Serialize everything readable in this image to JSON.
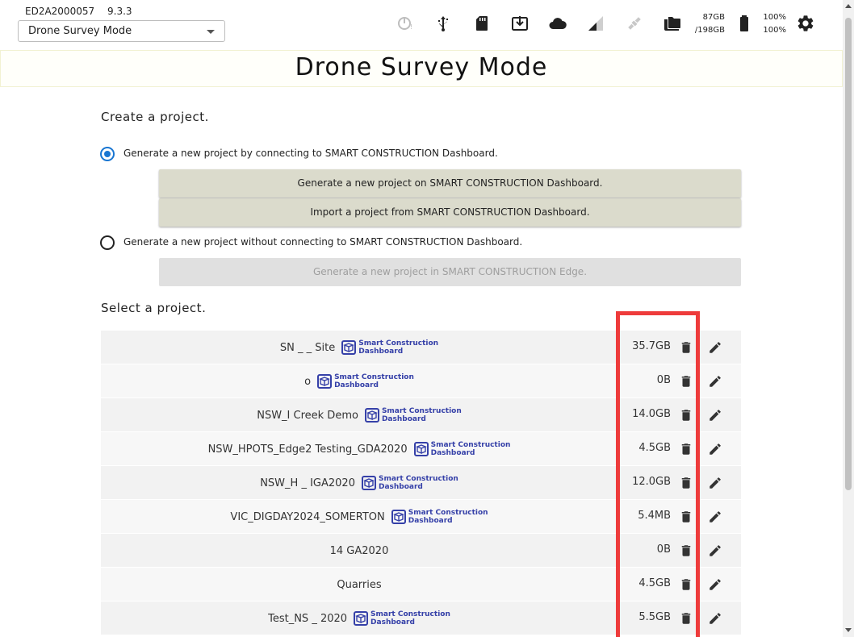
{
  "header": {
    "device_id": "ED2A2000057",
    "version": "9.3.3",
    "mode_select": {
      "value": "Drone Survey Mode"
    },
    "status_icons": [
      "gps-status-icon",
      "usb-icon",
      "sd-card-icon",
      "download-icon",
      "cloud-icon",
      "signal-icon",
      "satellite-icon",
      "folder-icon",
      "battery-icon",
      "settings-icon"
    ],
    "storage": {
      "used": "87GB",
      "total": "/198GB"
    },
    "battery": {
      "level1": "100%",
      "level2": "100%"
    }
  },
  "title": "Drone Survey Mode",
  "create": {
    "heading": "Create a project.",
    "option_connected": "Generate a new project by connecting to SMART CONSTRUCTION Dashboard.",
    "btn_generate_dashboard": "Generate a new project on SMART CONSTRUCTION Dashboard.",
    "btn_import_dashboard": "Import a project from SMART CONSTRUCTION Dashboard.",
    "option_offline": "Generate a new project without connecting to SMART CONSTRUCTION Dashboard.",
    "btn_generate_edge": "Generate a new project in SMART CONSTRUCTION Edge."
  },
  "select": {
    "heading": "Select a project.",
    "badge_line1": "Smart Construction",
    "badge_line2": "Dashboard",
    "projects": [
      {
        "name": "SN _ _ Site",
        "badge": true,
        "size": "35.7GB"
      },
      {
        "name": "o",
        "badge": true,
        "size": "0B"
      },
      {
        "name": "NSW_I Creek Demo",
        "badge": true,
        "size": "14.0GB"
      },
      {
        "name": "NSW_HPOTS_Edge2 Testing_GDA2020",
        "badge": true,
        "size": "4.5GB"
      },
      {
        "name": "NSW_H _ IGA2020",
        "badge": true,
        "size": "12.0GB"
      },
      {
        "name": "VIC_DIGDAY2024_SOMERTON",
        "badge": true,
        "size": "5.4MB"
      },
      {
        "name": "14 GA2020",
        "badge": false,
        "size": "0B"
      },
      {
        "name": "Quarries",
        "badge": false,
        "size": "4.5GB"
      },
      {
        "name": "Test_NS _ 2020",
        "badge": true,
        "size": "5.5GB"
      }
    ]
  },
  "colors": {
    "accent": "#1976d2",
    "button_bg": "#dbdbcc",
    "highlight": "#ee3b3b",
    "brand": "#3540a8"
  }
}
